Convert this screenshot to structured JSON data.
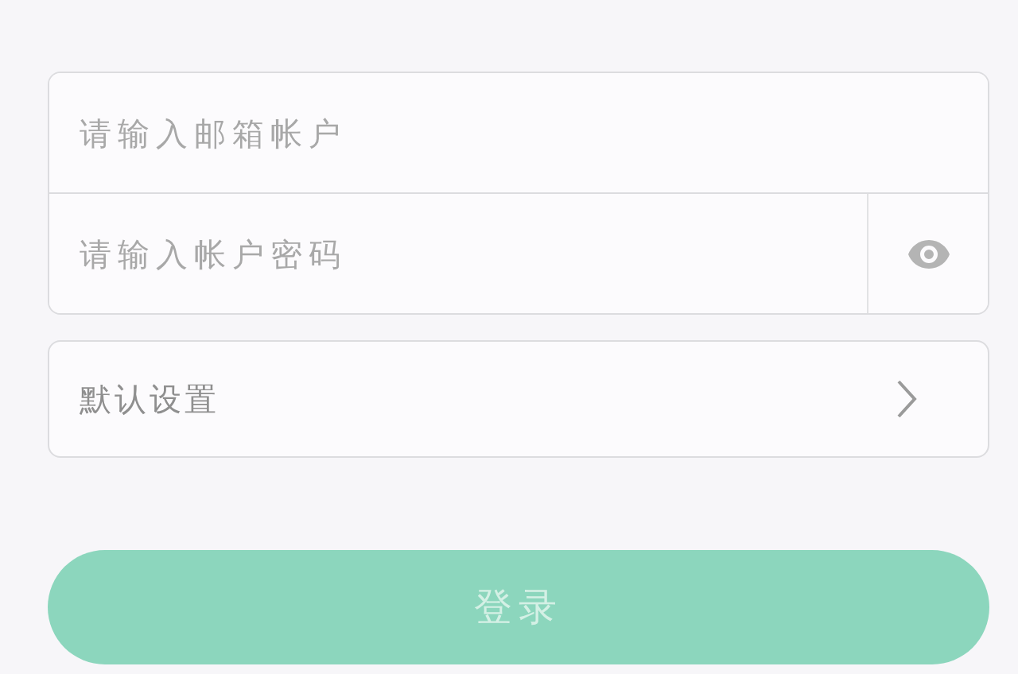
{
  "login_form": {
    "email_field": {
      "placeholder": "请输入邮箱帐户"
    },
    "password_field": {
      "placeholder": "请输入帐户密码"
    },
    "settings_row": {
      "label": "默认设置"
    },
    "login_button": {
      "label": "登录",
      "disabled": true
    }
  }
}
